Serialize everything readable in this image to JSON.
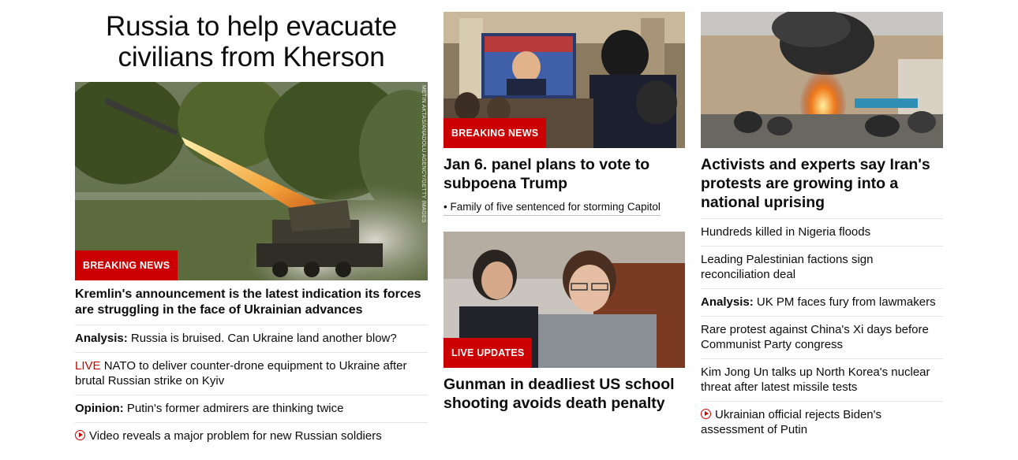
{
  "col1": {
    "headline": "Russia to help evacuate civilians from Kherson",
    "image": {
      "credit": "METIN AKTAS/ANADOLU AGENCY/GETTY IMAGES",
      "badge": "BREAKING NEWS"
    },
    "lead": "Kremlin's announcement is the latest indication its forces are struggling in the face of Ukrainian advances",
    "items": [
      {
        "label": "Analysis:",
        "text": " Russia is bruised. Can Ukraine land another blow?"
      },
      {
        "live": "LIVE",
        "text": " NATO to deliver counter-drone equipment to Ukraine after brutal Russian strike on Kyiv"
      },
      {
        "label": "Opinion:",
        "text": " Putin's former admirers are thinking twice"
      },
      {
        "video": "play-icon",
        "text": "Video reveals a major problem for new Russian soldiers"
      }
    ]
  },
  "col2": {
    "story1": {
      "badge": "BREAKING NEWS",
      "headline": "Jan 6. panel plans to vote to subpoena Trump",
      "sub": "• Family of five sentenced for storming Capitol"
    },
    "story2": {
      "badge": "LIVE UPDATES",
      "headline": "Gunman in deadliest US school shooting avoids death penalty"
    }
  },
  "col3": {
    "headline": "Activists and experts say Iran's protests are growing into a national uprising",
    "items": [
      {
        "text": "Hundreds killed in Nigeria floods"
      },
      {
        "text": "Leading Palestinian factions sign reconciliation deal"
      },
      {
        "label": "Analysis:",
        "text": " UK PM faces fury from lawmakers"
      },
      {
        "text": "Rare protest against China's Xi days before Communist Party congress"
      },
      {
        "text": "Kim Jong Un talks up North Korea's nuclear threat after latest missile tests"
      },
      {
        "video": "play-icon",
        "text": "Ukrainian official rejects Biden's assessment of Putin"
      }
    ]
  },
  "colors": {
    "accent": "#cc0000",
    "text": "#0c0c0c",
    "divider": "#e6e6e6"
  }
}
